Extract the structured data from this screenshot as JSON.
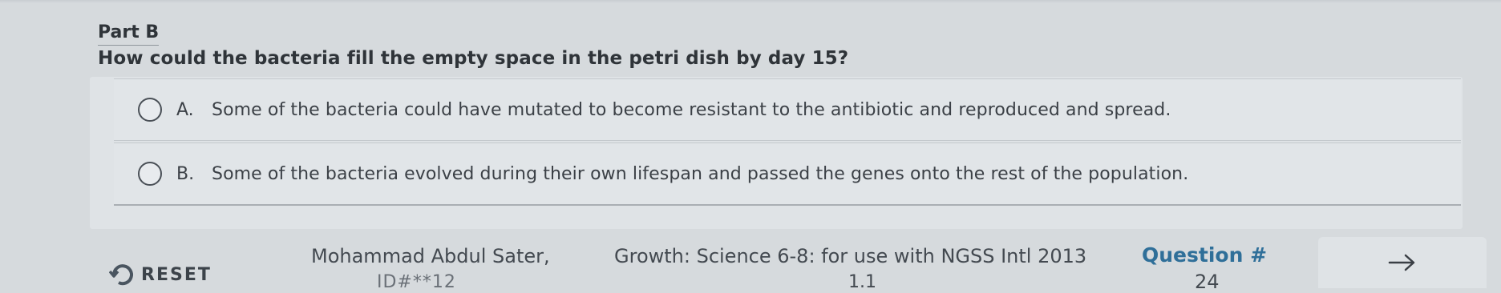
{
  "question": {
    "part_label": "Part B",
    "prompt": "How could the bacteria fill the empty space in the petri dish by day 15?"
  },
  "options": [
    {
      "letter": "A.",
      "text": "Some of the bacteria could have mutated to become resistant to the antibiotic and reproduced and spread.",
      "selected": false
    },
    {
      "letter": "B.",
      "text": "Some of the bacteria evolved during their own lifespan and passed the genes onto the rest of the population.",
      "selected": false
    }
  ],
  "footer": {
    "reset_label": "RESET",
    "reset_icon": "refresh-icon",
    "author": "Mohammad Abdul Sater,",
    "book": "Growth: Science 6-8: for use with NGSS Intl 2013",
    "id": "ID#**12",
    "version": "1.1",
    "question_number_label": "Question #",
    "question_number": "24",
    "next_icon": "arrow-right-icon"
  },
  "colors": {
    "background": "#d6dadd",
    "accent": "#2f6f99"
  }
}
